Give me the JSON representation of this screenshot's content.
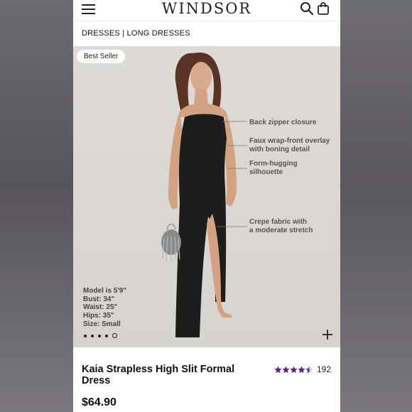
{
  "header": {
    "logo": "WINDSOR",
    "menu_icon": "hamburger-menu-icon",
    "search_icon": "search-icon",
    "bag_icon": "shopping-bag-icon"
  },
  "breadcrumb": "DRESSES | LONG DRESSES",
  "hero": {
    "badge": "Best Seller",
    "annotations": [
      {
        "line1": "Back zipper closure",
        "line2": ""
      },
      {
        "line1": "Faux wrap-front overlay",
        "line2": "with boning detail"
      },
      {
        "line1": "Form-hugging",
        "line2": "silhouette"
      },
      {
        "line1": "Crepe fabric with",
        "line2": "a moderate stretch"
      }
    ],
    "model_info": [
      "Model is 5'9\"",
      "Bust: 34\"",
      "Waist: 25\"",
      "Hips: 35\"",
      "Size: Small"
    ],
    "carousel": {
      "total": 5,
      "active": 5
    },
    "zoom_icon": "plus-icon"
  },
  "product": {
    "title": "Kaia Strapless High Slit Formal Dress",
    "rating": 4.5,
    "review_count": "192",
    "price": "$64.90"
  },
  "colors": {
    "star": "#5b2d7f",
    "dress": "#1c1d1c",
    "background": "#dad7d2"
  }
}
